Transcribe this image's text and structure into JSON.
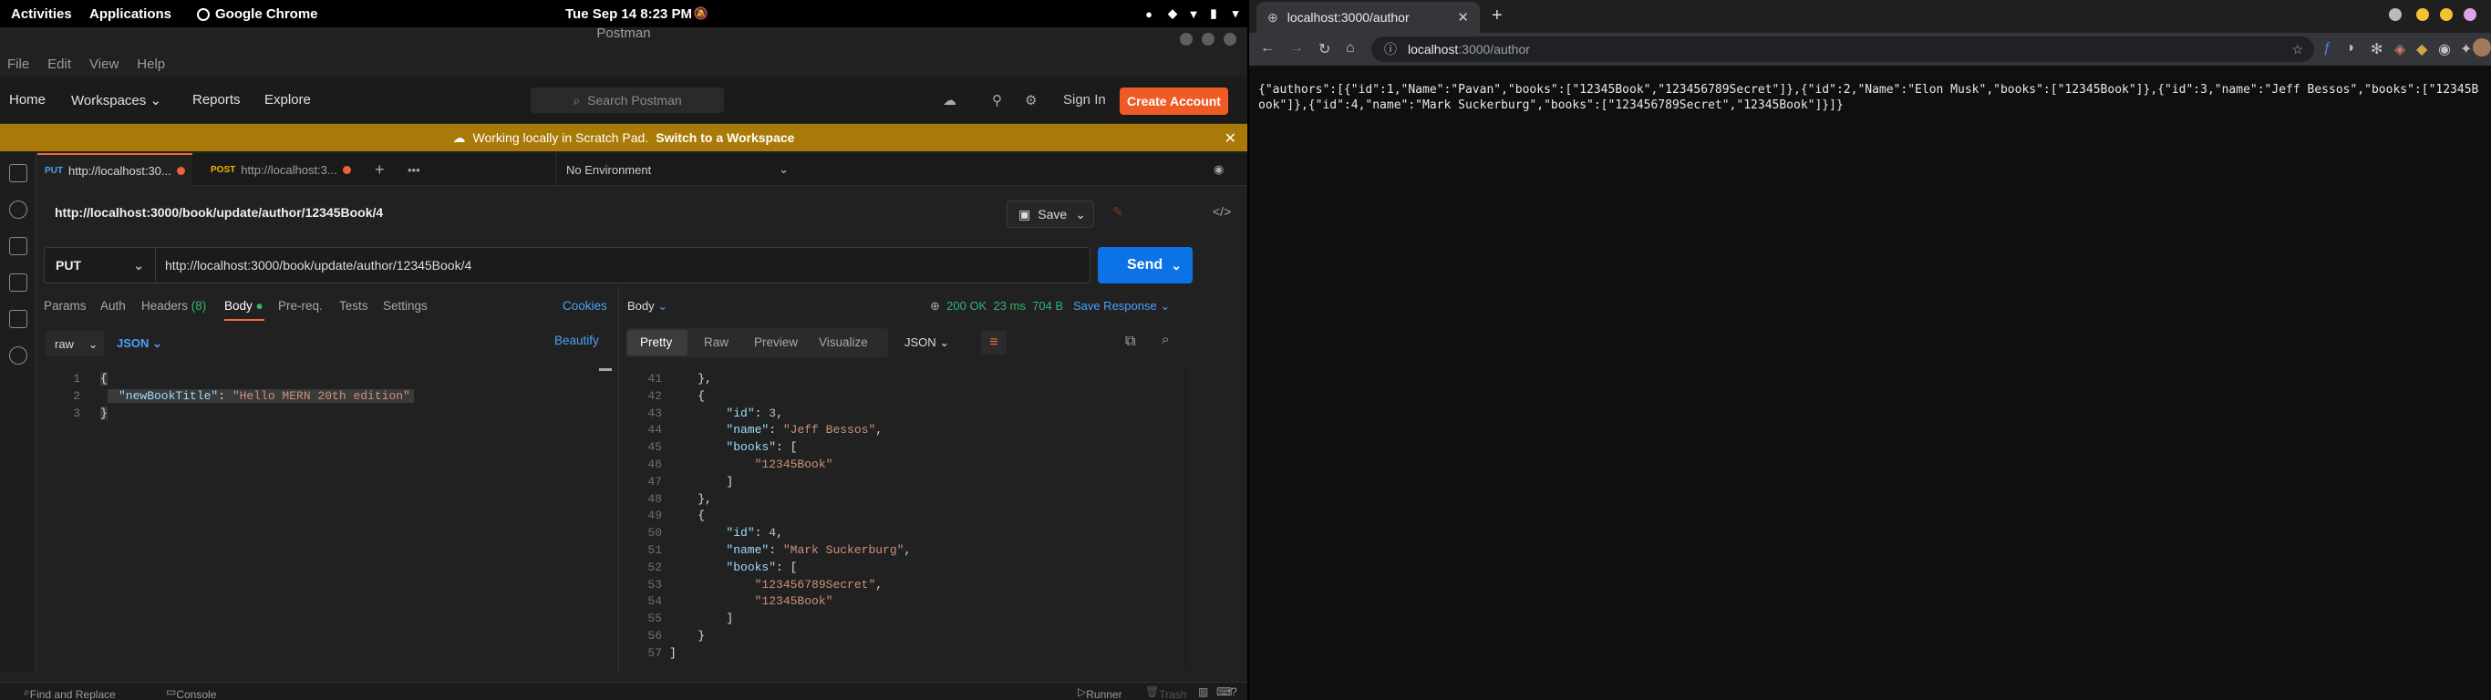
{
  "topbar": {
    "activities": "Activities",
    "applications": "Applications",
    "chrome_app": "Google Chrome",
    "clock": "Tue Sep 14  8:23 PM"
  },
  "postman": {
    "window_title": "Postman",
    "menu": [
      "File",
      "Edit",
      "View",
      "Help"
    ],
    "nav": {
      "home": "Home",
      "workspaces": "Workspaces",
      "reports": "Reports",
      "explore": "Explore"
    },
    "search_placeholder": "Search Postman",
    "sign_in": "Sign In",
    "create_account": "Create Account",
    "banner_text": "Working locally in Scratch Pad.",
    "banner_link": "Switch to a Workspace",
    "tabs": [
      {
        "method": "PUT",
        "label": "http://localhost:30..."
      },
      {
        "method": "POST",
        "label": "http://localhost:3..."
      }
    ],
    "environment": "No Environment",
    "request_name": "http://localhost:3000/book/update/author/12345Book/4",
    "save": "Save",
    "method": "PUT",
    "url": "http://localhost:3000/book/update/author/12345Book/4",
    "send": "Send",
    "request_tabs": {
      "params": "Params",
      "auth": "Auth",
      "headers": "Headers",
      "headers_count": "(8)",
      "body": "Body",
      "prereq": "Pre-req.",
      "tests": "Tests",
      "settings": "Settings",
      "cookies": "Cookies"
    },
    "body_type": "raw",
    "body_format": "JSON",
    "beautify": "Beautify",
    "request_body": [
      {
        "n": "1",
        "text": "{"
      },
      {
        "n": "2",
        "key": "\"newBookTitle\"",
        "value": "\"Hello MERN 20th edition\""
      },
      {
        "n": "3",
        "text": "}"
      }
    ],
    "response": {
      "label": "Body",
      "status": "200 OK",
      "time": "23 ms",
      "size": "704 B",
      "save_response": "Save Response",
      "views": [
        "Pretty",
        "Raw",
        "Preview",
        "Visualize"
      ],
      "format": "JSON"
    },
    "response_lines": [
      {
        "n": "41",
        "code": "    },"
      },
      {
        "n": "42",
        "code": "    {"
      },
      {
        "n": "43",
        "code": "        \"id\": 3,"
      },
      {
        "n": "44",
        "code": "        \"name\": \"Jeff Bessos\","
      },
      {
        "n": "45",
        "code": "        \"books\": ["
      },
      {
        "n": "46",
        "code": "            \"12345Book\""
      },
      {
        "n": "47",
        "code": "        ]"
      },
      {
        "n": "48",
        "code": "    },"
      },
      {
        "n": "49",
        "code": "    {"
      },
      {
        "n": "50",
        "code": "        \"id\": 4,"
      },
      {
        "n": "51",
        "code": "        \"name\": \"Mark Suckerburg\","
      },
      {
        "n": "52",
        "code": "        \"books\": ["
      },
      {
        "n": "53",
        "code": "            \"123456789Secret\","
      },
      {
        "n": "54",
        "code": "            \"12345Book\""
      },
      {
        "n": "55",
        "code": "        ]"
      },
      {
        "n": "56",
        "code": "    }"
      },
      {
        "n": "57",
        "code": "]"
      }
    ],
    "bottom": {
      "find_replace": "Find and Replace",
      "console": "Console",
      "runner": "Runner",
      "trash": "Trash"
    }
  },
  "chrome": {
    "tab_title": "localhost:3000/author",
    "url_host": "localhost",
    "url_path": ":3000/author",
    "page_text": "{\"authors\":[{\"id\":1,\"Name\":\"Pavan\",\"books\":[\"12345Book\",\"123456789Secret\"]},{\"id\":2,\"Name\":\"Elon Musk\",\"books\":[\"12345Book\"]},{\"id\":3,\"name\":\"Jeff Bessos\",\"books\":[\"12345Book\"]},{\"id\":4,\"name\":\"Mark Suckerburg\",\"books\":[\"123456789Secret\",\"12345Book\"]}]}"
  },
  "colors": {
    "accent": "#ef5b25",
    "send": "#0c73e6",
    "banner": "#a97a07",
    "ok": "#2fb673",
    "link": "#4ea0f5"
  }
}
